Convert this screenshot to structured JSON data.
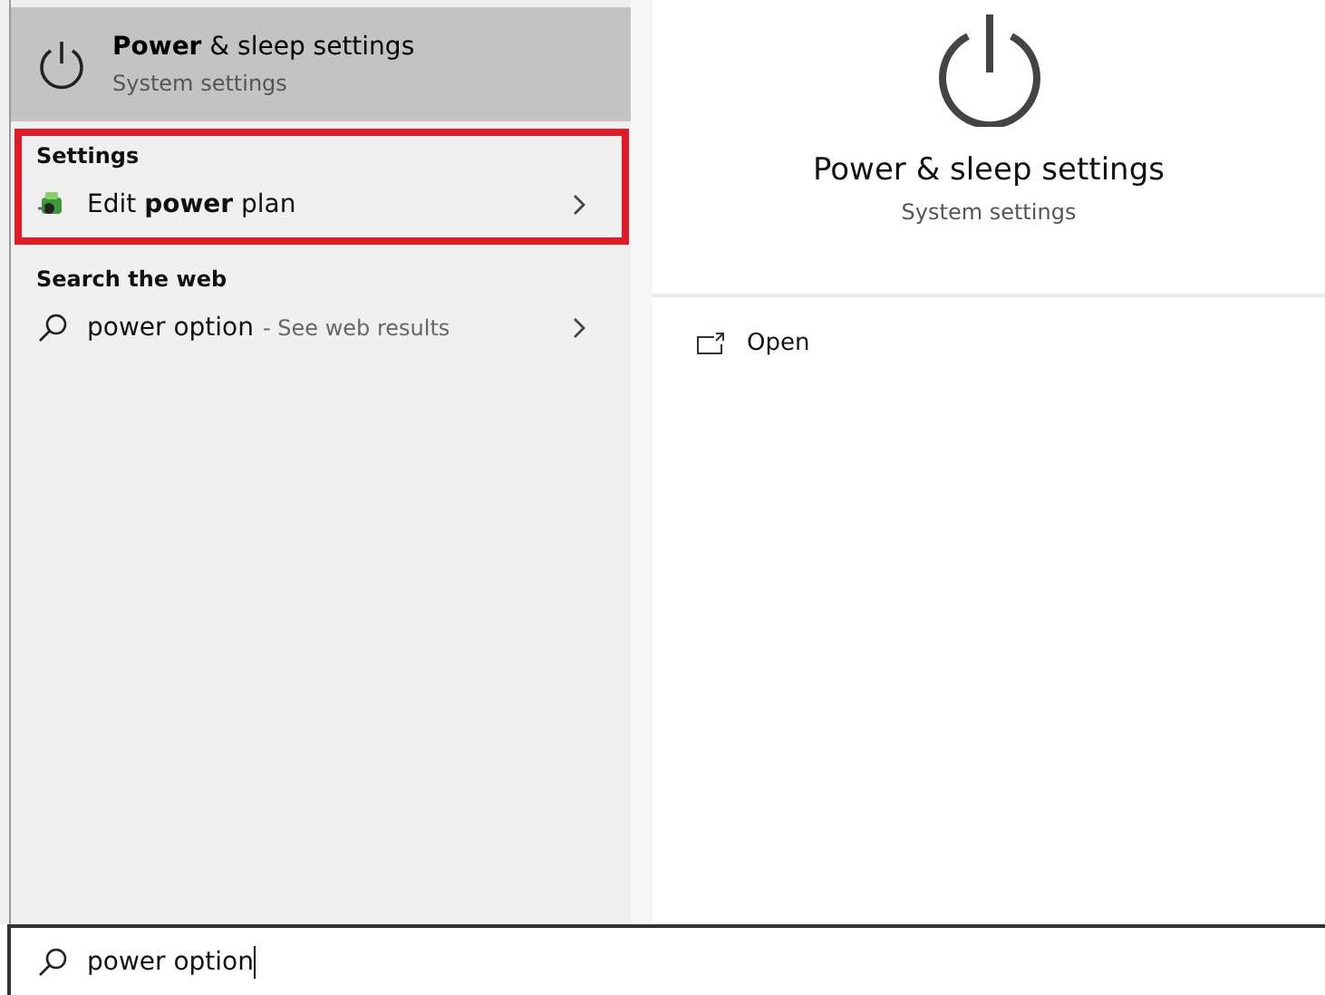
{
  "best_match": {
    "title": "**Power** & sleep settings",
    "subtitle": "System settings",
    "selected": true
  },
  "sections": [
    {
      "heading": "Settings",
      "highlighted": true,
      "items": [
        {
          "kind": "app",
          "label": "Edit **power** plan",
          "selected": false
        }
      ]
    },
    {
      "heading": "Search the web",
      "highlighted": false,
      "items": [
        {
          "kind": "web",
          "label": "power option",
          "suffix": "- See web results",
          "selected": false
        }
      ]
    }
  ],
  "preview": {
    "title": "Power & sleep settings",
    "subtitle": "System settings",
    "actions": [
      {
        "label": "Open"
      }
    ]
  },
  "search": {
    "value": "power option"
  }
}
